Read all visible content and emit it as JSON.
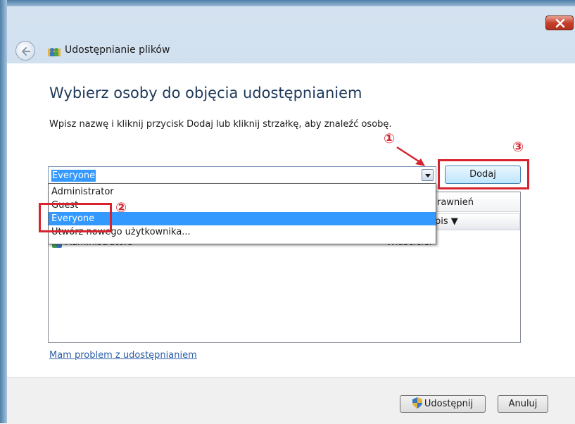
{
  "window": {
    "title": "Udostępnianie plików",
    "close_icon": "close-icon",
    "back_icon": "back-arrow-icon",
    "app_icon": "sharing-icon"
  },
  "main": {
    "heading": "Wybierz osoby do objęcia udostępnianiem",
    "instruction": "Wpisz nazwę i kliknij przycisk Dodaj lub kliknij strzałkę, aby znaleźć osobę.",
    "combo_value": "Everyone",
    "add_button": "Dodaj",
    "dropdown_options": [
      "Administrator",
      "Guest",
      "Everyone",
      "Utwórz nowego użytkownika..."
    ],
    "selected_option": "Everyone",
    "list": {
      "permission_header": "rawnień",
      "description_sort": "pis ▼",
      "rows": [
        {
          "name": "Administrators",
          "permission": "Właściciel"
        }
      ]
    },
    "help_link": "Mam problem z udostępnianiem"
  },
  "footer": {
    "share_button": "Udostępnij",
    "cancel_button": "Anuluj"
  },
  "annotations": {
    "callout_1": "①",
    "callout_2": "②",
    "callout_3": "③",
    "color": "#d6232e"
  }
}
